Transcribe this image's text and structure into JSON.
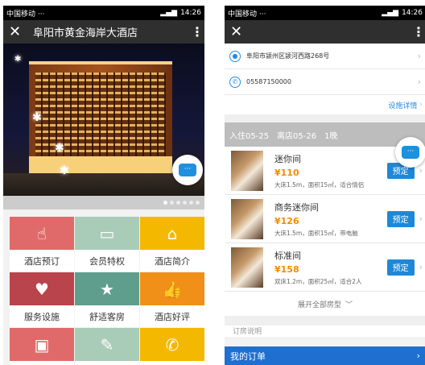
{
  "left": {
    "status": {
      "carrier": "中国移动 ···",
      "time": "14:26"
    },
    "title": "阜阳市黄金海岸大酒店",
    "grid": [
      {
        "label": "酒店预订",
        "icon": "hand-pointer-icon",
        "glyph": "☝",
        "color": "#e06a6a"
      },
      {
        "label": "会员特权",
        "icon": "card-icon",
        "glyph": "▭",
        "color": "#a9ccb9"
      },
      {
        "label": "酒店简介",
        "icon": "home-icon",
        "glyph": "⌂",
        "color": "#f5b800"
      },
      {
        "label": "服务设施",
        "icon": "heart-icon",
        "glyph": "♥",
        "color": "#b9444c"
      },
      {
        "label": "舒适客房",
        "icon": "star-icon",
        "glyph": "★",
        "color": "#5f9e8c"
      },
      {
        "label": "酒店好评",
        "icon": "thumbs-up-icon",
        "glyph": "👍",
        "color": "#f09019"
      },
      {
        "label": "",
        "icon": "briefcase-icon",
        "glyph": "▣",
        "color": "#e06a6a"
      },
      {
        "label": "",
        "icon": "edit-icon",
        "glyph": "✎",
        "color": "#a9ccb9"
      },
      {
        "label": "",
        "icon": "phone-icon",
        "glyph": "✆",
        "color": "#f5b800"
      }
    ]
  },
  "right": {
    "status": {
      "carrier": "中国移动 ···",
      "time": "14:26"
    },
    "address": "阜阳市颍州区颍河西路268号",
    "phone": "05587150000",
    "facilities_link": "设施详情",
    "date_bar": {
      "checkin": "入住05-25",
      "checkout": "离店05-26",
      "nights": "1晚"
    },
    "rooms": [
      {
        "name": "迷你间",
        "price": "¥110",
        "desc": "大床1.5m，面积15㎡，适合情侣",
        "book": "预定"
      },
      {
        "name": "商务迷你间",
        "price": "¥126",
        "desc": "大床1.5m，面积15㎡，带电脑",
        "book": "预定"
      },
      {
        "name": "标准间",
        "price": "¥158",
        "desc": "双床1.2m，面积25㎡，适合2人",
        "book": "预定"
      }
    ],
    "expand_label": "展开全部房型",
    "partial_text": "订房说明",
    "orders_label": "我的订单"
  }
}
